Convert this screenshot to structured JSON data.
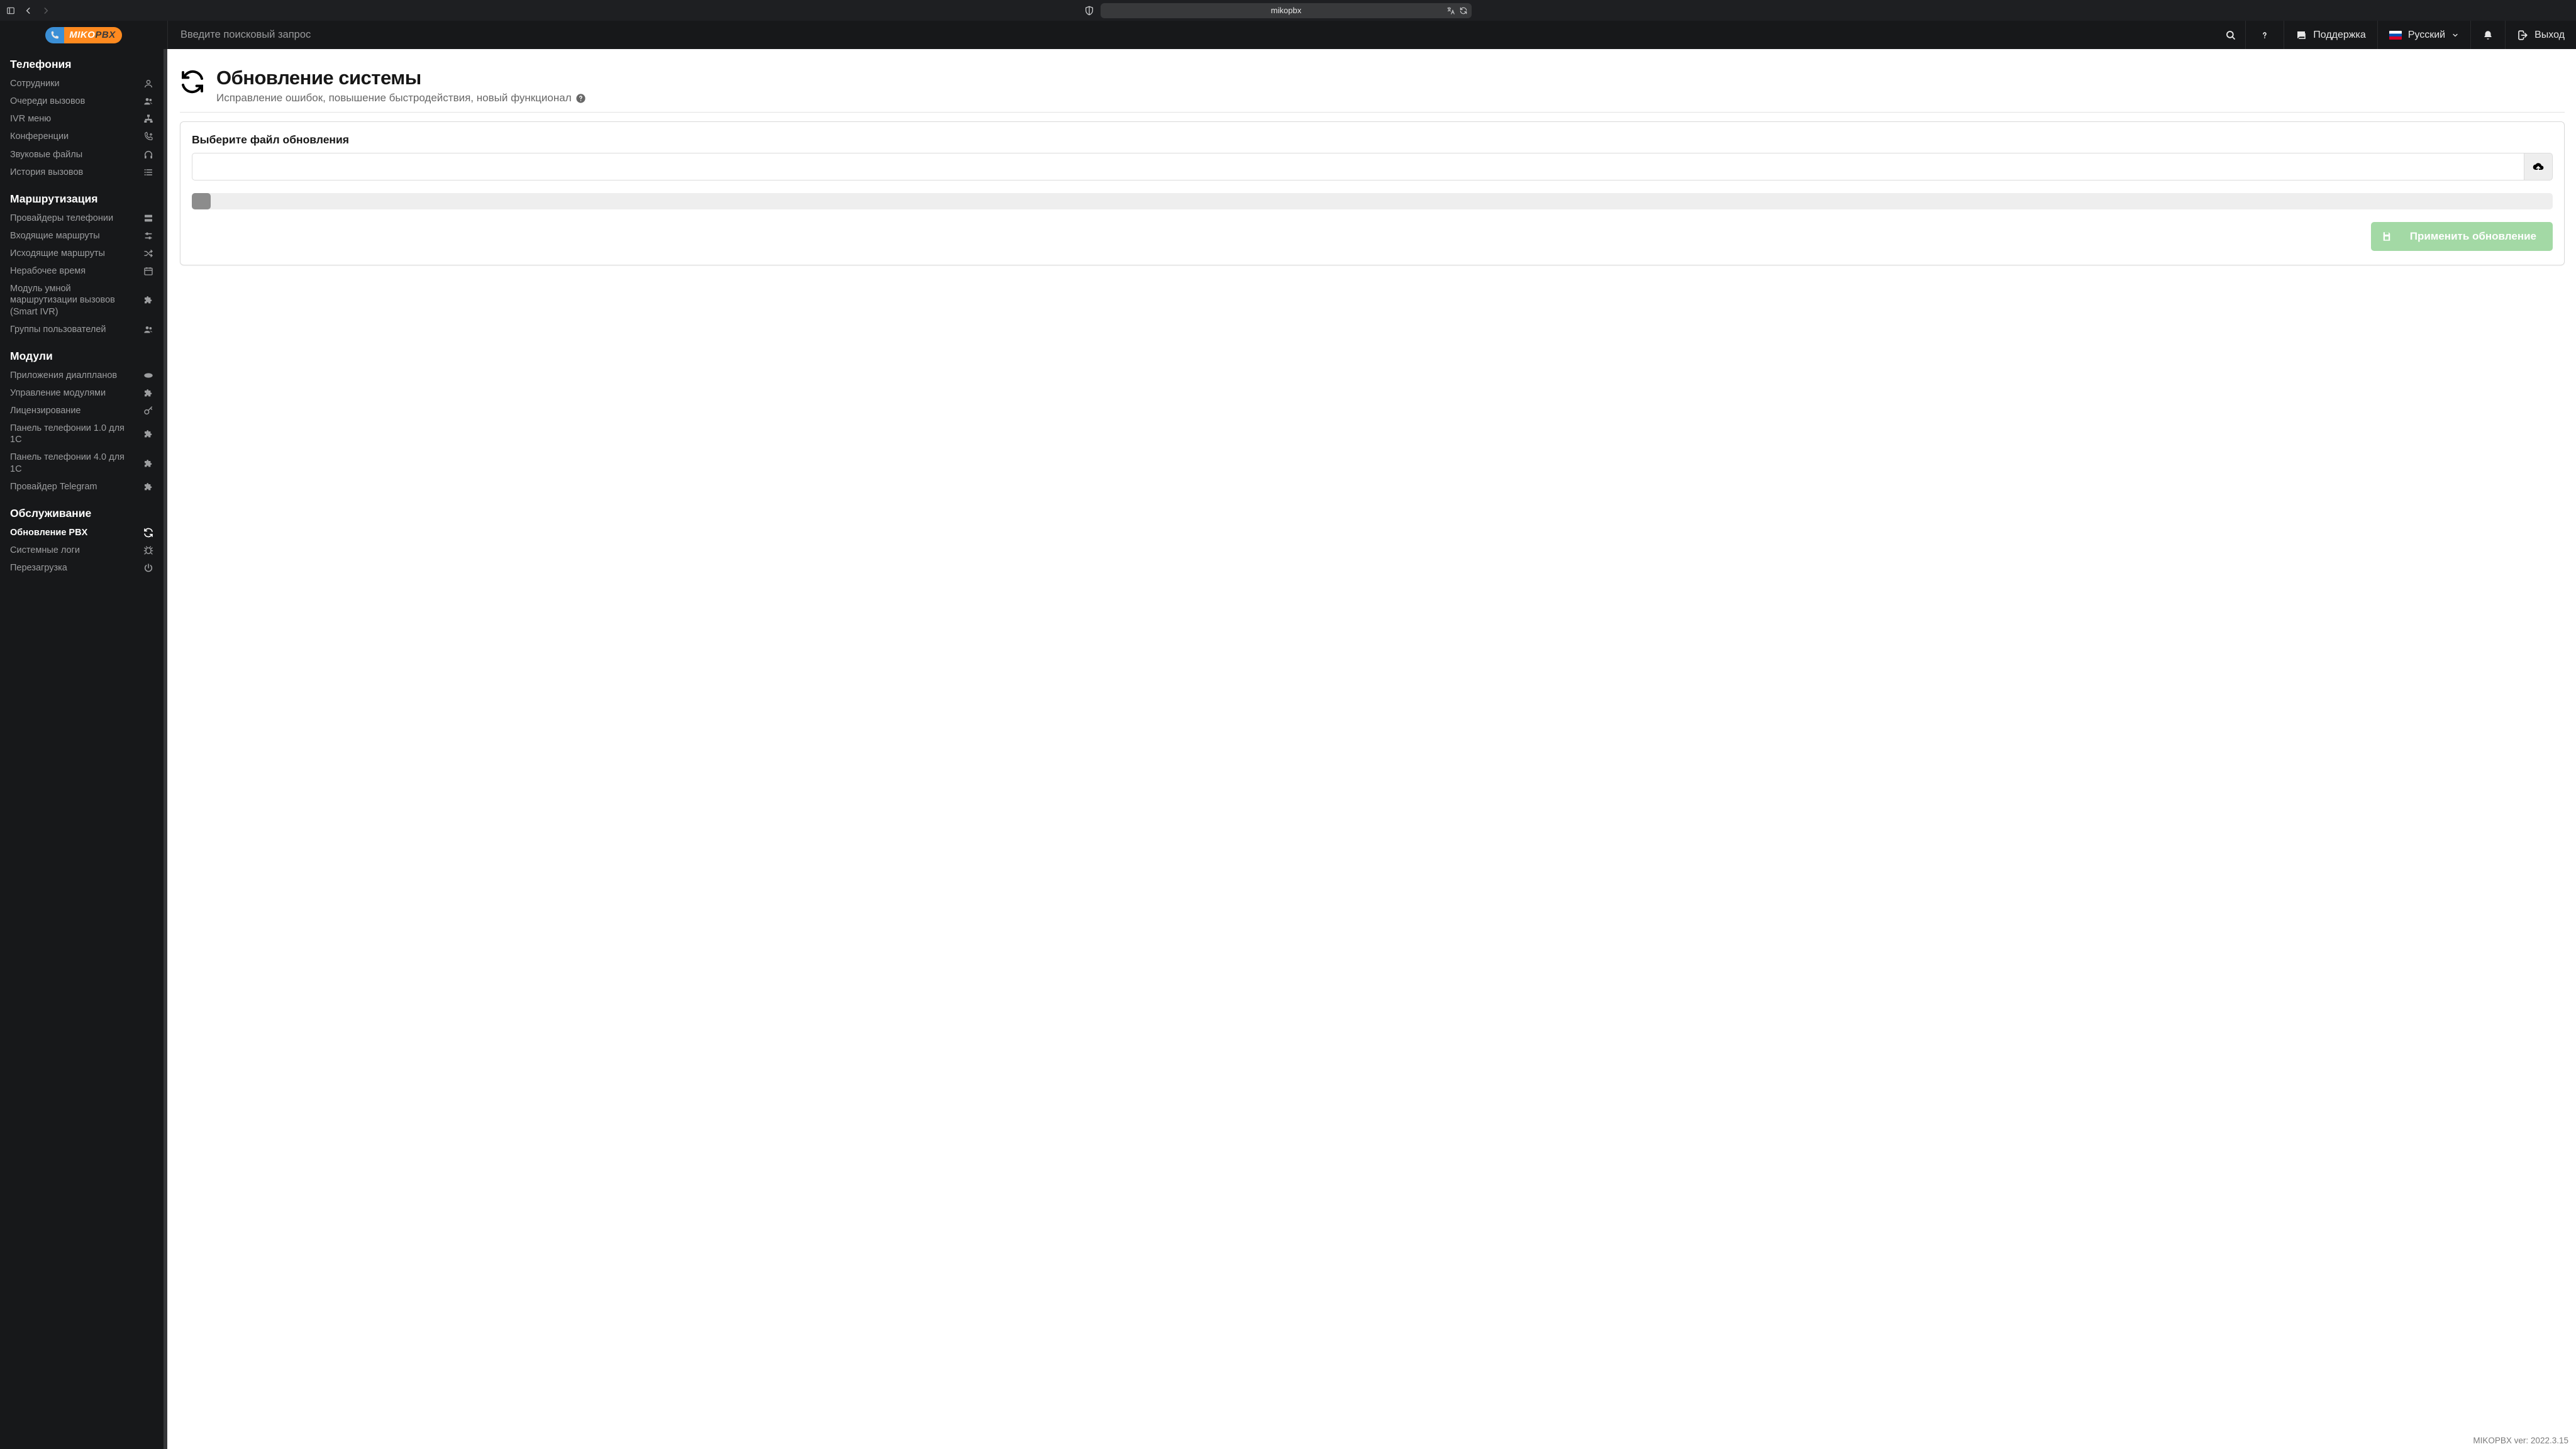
{
  "browser": {
    "url_display": "mikopbx"
  },
  "logo": {
    "part1": "MIKO",
    "part2": "PBX"
  },
  "topbar": {
    "search_placeholder": "Введите поисковый запрос",
    "support": "Поддержка",
    "language": "Русский",
    "logout": "Выход"
  },
  "sidebar": {
    "groups": [
      {
        "title": "Телефония",
        "items": [
          {
            "label": "Сотрудники",
            "icon": "user"
          },
          {
            "label": "Очереди вызовов",
            "icon": "users"
          },
          {
            "label": "IVR меню",
            "icon": "sitemap"
          },
          {
            "label": "Конференции",
            "icon": "phone-up"
          },
          {
            "label": "Звуковые файлы",
            "icon": "headphones"
          },
          {
            "label": "История вызовов",
            "icon": "list"
          }
        ]
      },
      {
        "title": "Маршрутизация",
        "items": [
          {
            "label": "Провайдеры телефонии",
            "icon": "server"
          },
          {
            "label": "Входящие маршруты",
            "icon": "sliders"
          },
          {
            "label": "Исходящие маршруты",
            "icon": "shuffle"
          },
          {
            "label": "Нерабочее время",
            "icon": "calendar"
          },
          {
            "label": "Модуль умной маршрутизации вызовов (Smart IVR)",
            "icon": "puzzle"
          },
          {
            "label": "Группы пользователей",
            "icon": "users"
          }
        ]
      },
      {
        "title": "Модули",
        "items": [
          {
            "label": "Приложения диалпланов",
            "icon": "php"
          },
          {
            "label": "Управление модулями",
            "icon": "puzzle"
          },
          {
            "label": "Лицензирование",
            "icon": "key"
          },
          {
            "label": "Панель телефонии 1.0 для 1С",
            "icon": "puzzle"
          },
          {
            "label": "Панель телефонии 4.0 для 1С",
            "icon": "puzzle"
          },
          {
            "label": "Провайдер Telegram",
            "icon": "puzzle"
          }
        ]
      },
      {
        "title": "Обслуживание",
        "items": [
          {
            "label": "Обновление PBX",
            "icon": "sync",
            "active": true
          },
          {
            "label": "Системные логи",
            "icon": "bug"
          },
          {
            "label": "Перезагрузка",
            "icon": "power"
          }
        ]
      }
    ]
  },
  "page": {
    "title": "Обновление системы",
    "subtitle": "Исправление ошибок, повышение быстродействия, новый функционал",
    "file_label": "Выберите файл обновления",
    "apply_label": "Применить обновление"
  },
  "footer": {
    "version": "MIKOPBX ver: 2022.3.15"
  }
}
